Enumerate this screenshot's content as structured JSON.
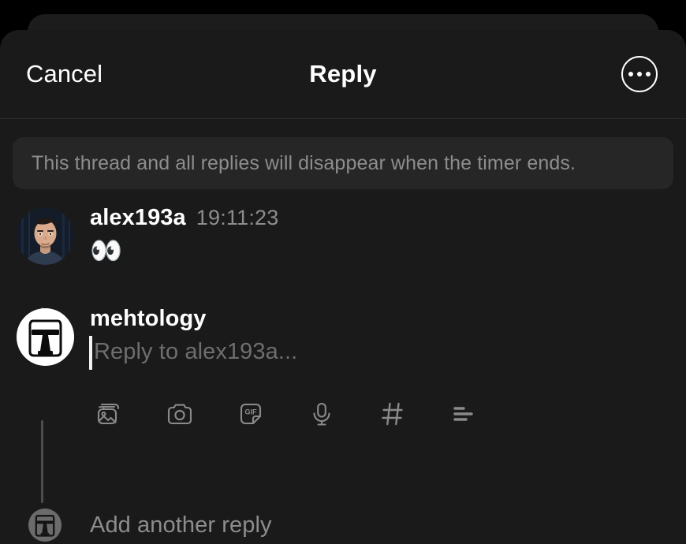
{
  "header": {
    "cancel_label": "Cancel",
    "title": "Reply",
    "more_icon": "more-options-icon"
  },
  "banner": {
    "text": "This thread and all replies will disappear when the timer ends."
  },
  "thread": {
    "messages": [
      {
        "username": "alex193a",
        "timestamp": "19:11:23",
        "content": "👀",
        "avatar_name": "avatar-alex193a"
      }
    ],
    "composer": {
      "username": "mehtology",
      "placeholder": "Reply to alex193a...",
      "value": "",
      "avatar_name": "avatar-mehtology"
    },
    "toolbar": [
      {
        "name": "photo-gallery-icon",
        "label": "Photo"
      },
      {
        "name": "camera-icon",
        "label": "Camera"
      },
      {
        "name": "gif-sticker-icon",
        "label": "GIF"
      },
      {
        "name": "microphone-icon",
        "label": "Voice"
      },
      {
        "name": "hashtag-icon",
        "label": "Tag"
      },
      {
        "name": "poll-icon",
        "label": "Poll"
      }
    ],
    "add_another": {
      "label": "Add another reply"
    }
  },
  "colors": {
    "background": "#000000",
    "sheet": "#1a1a1a",
    "sheet_behind": "#1c1c1c",
    "banner": "#262626",
    "text_primary": "#ffffff",
    "text_secondary": "#8d8d8d",
    "placeholder": "#6e6e6e",
    "icon": "#8a8a8a",
    "connector": "#4d4d4d",
    "divider": "#2d2d2d"
  }
}
